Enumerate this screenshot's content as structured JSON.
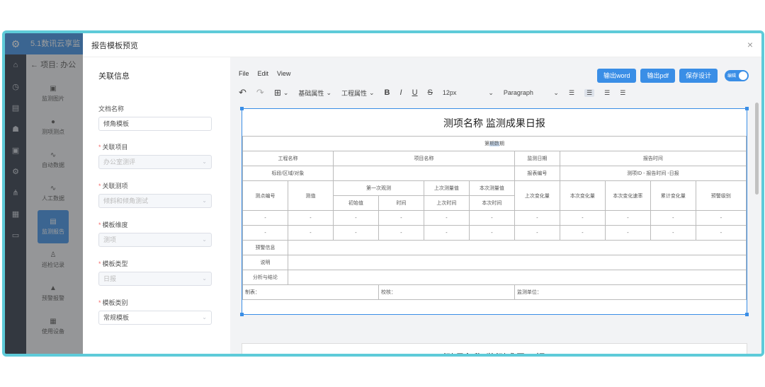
{
  "app": {
    "title": "5.1数讯云享监",
    "back_label": "项目: 办公",
    "nav_icons": [
      "home-icon",
      "clock-icon",
      "chart-icon",
      "user-icon",
      "monitor-icon",
      "gear-icon",
      "network-icon",
      "grid-icon",
      "screen-icon"
    ],
    "subnav": [
      {
        "label": "监测图片",
        "active": false
      },
      {
        "label": "测项测点",
        "active": false
      },
      {
        "label": "自动数据",
        "active": false
      },
      {
        "label": "人工数据",
        "active": false
      },
      {
        "label": "监测报告",
        "active": true
      },
      {
        "label": "巡检记录",
        "active": false
      },
      {
        "label": "预警报警",
        "active": false
      },
      {
        "label": "使用设备",
        "active": false
      }
    ]
  },
  "dialog": {
    "title": "报告模板预览",
    "close": "×"
  },
  "form": {
    "section_title": "关联信息",
    "doc_name_label": "文档名称",
    "doc_name_value": "倾角模板",
    "project_label": "关联项目",
    "project_value": "办公室测评",
    "item_label": "关联测项",
    "item_value": "倾斜和倾角测试",
    "dimension_label": "模板维度",
    "dimension_value": "测项",
    "type_label": "模板类型",
    "type_value": "日报",
    "category_label": "模板类别",
    "category_value": "常规模板"
  },
  "editor": {
    "menu": [
      "File",
      "Edit",
      "View"
    ],
    "undo": "↶",
    "redo": "↷",
    "table_menu": "⊞",
    "basic_attr": "基础属性",
    "project_attr": "工程属性",
    "bold": "B",
    "italic": "I",
    "underline": "U",
    "strike": "S",
    "font_size": "12px",
    "block_format": "Paragraph",
    "btn_word": "输出word",
    "btn_pdf": "输出pdf",
    "btn_save": "保存设计",
    "toggle_label": "编辑"
  },
  "report": {
    "title": "测项名称 监测成果日报",
    "period_pre": "第",
    "period_hl": "期数",
    "period_post": "期",
    "r1": [
      "工程名称",
      "项目名称",
      "监测日期",
      "报告时间"
    ],
    "r2": [
      "标段/区域/对象",
      "报表编号",
      "测项ID - 报告时间 -日报"
    ],
    "headers": [
      "测点编号",
      "测值",
      "第一次观测",
      "上次测量值",
      "本次测量值",
      "上次变化量",
      "本次变化量",
      "本次变化速率",
      "累计变化量",
      "预警级别"
    ],
    "subheaders": [
      "初始值",
      "时间",
      "上次时间",
      "本次时间"
    ],
    "rows": [
      [
        "-",
        "-",
        "-",
        "-",
        "-",
        "-",
        "-",
        "-",
        "-",
        "-",
        "-"
      ],
      [
        "-",
        "-",
        "-",
        "-",
        "-",
        "-",
        "-",
        "-",
        "-",
        "-",
        "-"
      ]
    ],
    "warn_label": "预警信息",
    "desc_label": "说明",
    "analysis_label": "分析与结论",
    "maker_label": "制表：",
    "checker_label": "校核：",
    "unit_label": "监测单位："
  }
}
